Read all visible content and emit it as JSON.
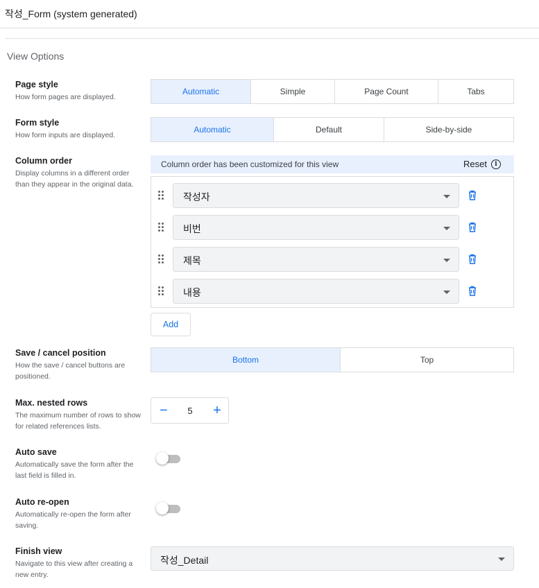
{
  "header": {
    "title": "작성_Form (system generated)"
  },
  "section_title": "View Options",
  "page_style": {
    "label": "Page style",
    "desc": "How form pages are displayed.",
    "options": [
      "Automatic",
      "Simple",
      "Page Count",
      "Tabs"
    ],
    "selected": "Automatic"
  },
  "form_style": {
    "label": "Form style",
    "desc": "How form inputs are displayed.",
    "options": [
      "Automatic",
      "Default",
      "Side-by-side"
    ],
    "selected": "Automatic"
  },
  "column_order": {
    "label": "Column order",
    "desc": "Display columns in a different order than they appear in the original data.",
    "banner": "Column order has been customized for this view",
    "reset_label": "Reset",
    "columns": [
      "작성자",
      "비번",
      "제목",
      "내용"
    ],
    "add_label": "Add"
  },
  "save_cancel": {
    "label": "Save / cancel position",
    "desc": "How the save / cancel buttons are positioned.",
    "options": [
      "Bottom",
      "Top"
    ],
    "selected": "Bottom"
  },
  "max_nested": {
    "label": "Max. nested rows",
    "desc": "The maximum number of rows to show for related references lists.",
    "value": "5",
    "minus": "−",
    "plus": "+"
  },
  "auto_save": {
    "label": "Auto save",
    "desc": "Automatically save the form after the last field is filled in.",
    "on": false
  },
  "auto_reopen": {
    "label": "Auto re-open",
    "desc": "Automatically re-open the form after saving.",
    "on": false
  },
  "finish_view": {
    "label": "Finish view",
    "desc": "Navigate to this view after creating a new entry.",
    "value": "작성_Detail"
  },
  "colors": {
    "accent": "#1a73e8",
    "selected_bg": "#e8f0fe",
    "field_bg": "#f1f3f4"
  },
  "icons": {
    "drag": "drag-handle-icon",
    "delete": "trash-icon",
    "info": "info-icon",
    "dropdown": "chevron-down-icon"
  }
}
